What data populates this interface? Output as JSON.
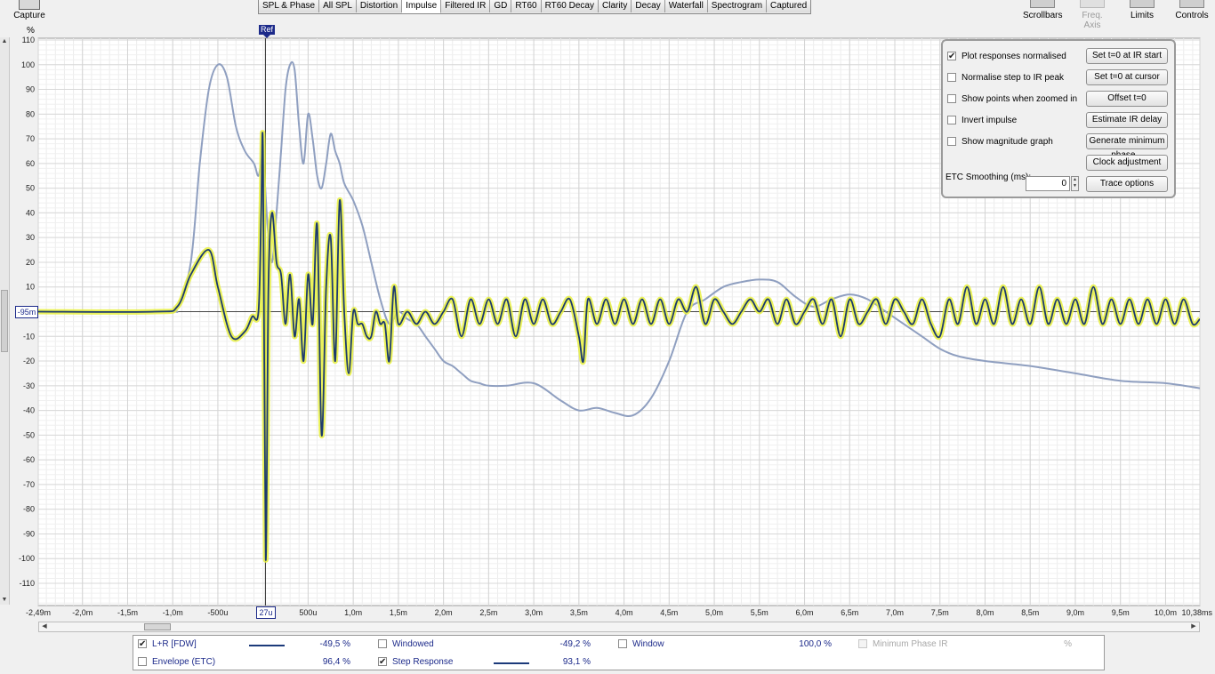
{
  "toolbar": {
    "capture_label": "Capture",
    "tabs": [
      "SPL & Phase",
      "All SPL",
      "Distortion",
      "Impulse",
      "Filtered IR",
      "GD",
      "RT60",
      "RT60 Decay",
      "Clarity",
      "Decay",
      "Waterfall",
      "Spectrogram",
      "Captured"
    ],
    "active_tab": "Impulse",
    "tools": [
      "Scrollbars",
      "Freq. Axis",
      "Limits",
      "Controls"
    ]
  },
  "plot": {
    "unit": "%",
    "ref_label": "Ref",
    "cursor_x_label": "27u",
    "cursor_y_label": "-95m"
  },
  "controls": {
    "checkboxes": [
      {
        "label": "Plot responses normalised",
        "checked": true
      },
      {
        "label": "Normalise step to IR peak",
        "checked": false
      },
      {
        "label": "Show points when zoomed in",
        "checked": false
      },
      {
        "label": "Invert impulse",
        "checked": false
      },
      {
        "label": "Show magnitude graph",
        "checked": false
      }
    ],
    "buttons": [
      "Set t=0 at IR start",
      "Set t=0 at cursor",
      "Offset t=0",
      "Estimate IR delay",
      "Generate minimum phase...",
      "Clock adjustment",
      "Trace options"
    ],
    "etc_label": "ETC Smoothing (ms):",
    "etc_value": "0"
  },
  "legend": {
    "items": [
      {
        "label": "L+R [FDW]",
        "checked": true,
        "value": "-49,5 %"
      },
      {
        "label": "Envelope (ETC)",
        "checked": false,
        "value": "96,4 %"
      },
      {
        "label": "Windowed",
        "checked": false,
        "value": "-49,2 %"
      },
      {
        "label": "Step Response",
        "checked": true,
        "value": "93,1 %"
      },
      {
        "label": "Window",
        "checked": false,
        "value": "100,0 %"
      },
      {
        "label": "Minimum Phase IR",
        "checked": false,
        "value": "%"
      }
    ]
  },
  "colors": {
    "impulse": "#1c3a6e",
    "impulse_glow": "#e8f040",
    "step": "#8f9fc0",
    "axis": "#1c2a8a"
  },
  "chart_data": {
    "type": "line",
    "ylabel": "%",
    "xlim": [
      -2.49,
      10.38
    ],
    "ylim": [
      -120,
      110
    ],
    "x_ticks": [
      "-2,49m",
      "-2,0m",
      "-1,5m",
      "-1,0m",
      "-500u",
      "27u",
      "500u",
      "1,0m",
      "1,5m",
      "2,0m",
      "2,5m",
      "3,0m",
      "3,5m",
      "4,0m",
      "4,5m",
      "5,0m",
      "5,5m",
      "6,0m",
      "6,5m",
      "7,0m",
      "7,5m",
      "8,0m",
      "8,5m",
      "9,0m",
      "9,5m",
      "10,0m",
      "10,38ms"
    ],
    "x_tick_values": [
      -2.49,
      -2.0,
      -1.5,
      -1.0,
      -0.5,
      0.027,
      0.5,
      1.0,
      1.5,
      2.0,
      2.5,
      3.0,
      3.5,
      4.0,
      4.5,
      5.0,
      5.5,
      6.0,
      6.5,
      7.0,
      7.5,
      8.0,
      8.5,
      9.0,
      9.5,
      10.0,
      10.38
    ],
    "y_ticks": [
      110,
      100,
      90,
      80,
      70,
      60,
      50,
      40,
      30,
      20,
      10,
      0,
      -10,
      -20,
      -30,
      -40,
      -50,
      -60,
      -70,
      -80,
      -90,
      -100,
      -110
    ],
    "series": [
      {
        "name": "L+R [FDW]",
        "color": "#1c3a6e",
        "x": [
          -2.49,
          -1.2,
          -0.95,
          -0.8,
          -0.6,
          -0.5,
          -0.35,
          -0.2,
          -0.12,
          -0.05,
          -0.02,
          0.0,
          0.03,
          0.06,
          0.1,
          0.15,
          0.2,
          0.25,
          0.3,
          0.35,
          0.4,
          0.45,
          0.5,
          0.55,
          0.6,
          0.65,
          0.7,
          0.75,
          0.8,
          0.85,
          0.9,
          0.95,
          1.0,
          1.05,
          1.1,
          1.15,
          1.2,
          1.25,
          1.3,
          1.35,
          1.4,
          1.45,
          1.5,
          1.6,
          1.7,
          1.8,
          1.9,
          2.0,
          2.1,
          2.2,
          2.3,
          2.4,
          2.5,
          2.6,
          2.7,
          2.8,
          2.9,
          3.0,
          3.1,
          3.2,
          3.3,
          3.4,
          3.5,
          3.55,
          3.6,
          3.7,
          3.8,
          3.9,
          4.0,
          4.1,
          4.2,
          4.3,
          4.4,
          4.5,
          4.6,
          4.7,
          4.8,
          4.9,
          5.0,
          5.1,
          5.2,
          5.3,
          5.4,
          5.5,
          5.6,
          5.7,
          5.8,
          5.9,
          6.0,
          6.1,
          6.2,
          6.3,
          6.4,
          6.5,
          6.6,
          6.7,
          6.8,
          6.9,
          7.0,
          7.1,
          7.2,
          7.3,
          7.4,
          7.5,
          7.6,
          7.7,
          7.8,
          7.9,
          8.0,
          8.1,
          8.2,
          8.3,
          8.4,
          8.5,
          8.6,
          8.7,
          8.8,
          8.9,
          9.0,
          9.1,
          9.2,
          9.3,
          9.4,
          9.5,
          9.6,
          9.7,
          9.8,
          9.9,
          10.0,
          10.1,
          10.2,
          10.3,
          10.38
        ],
        "y": [
          0,
          0,
          2,
          15,
          25,
          10,
          -10,
          -8,
          -2,
          0,
          40,
          65,
          -100,
          10,
          40,
          20,
          15,
          -5,
          15,
          -10,
          5,
          -20,
          15,
          -5,
          35,
          -50,
          10,
          30,
          -20,
          45,
          0,
          -25,
          0,
          -5,
          -5,
          -10,
          -10,
          0,
          -5,
          -5,
          -20,
          10,
          -5,
          0,
          -5,
          0,
          -5,
          0,
          5,
          -10,
          5,
          -5,
          5,
          -5,
          5,
          -10,
          5,
          -5,
          5,
          -5,
          0,
          5,
          -10,
          -20,
          5,
          -5,
          5,
          -5,
          5,
          -5,
          5,
          -5,
          5,
          -5,
          5,
          0,
          10,
          -5,
          5,
          0,
          -5,
          0,
          5,
          0,
          5,
          -5,
          5,
          -5,
          0,
          5,
          -5,
          5,
          -10,
          5,
          -5,
          0,
          5,
          -5,
          5,
          0,
          -5,
          5,
          -5,
          -10,
          5,
          -5,
          10,
          -5,
          5,
          -5,
          10,
          -5,
          5,
          -5,
          10,
          -5,
          5,
          -5,
          5,
          -5,
          10,
          -5,
          5,
          -5,
          5,
          -5,
          5,
          -5,
          5,
          -5,
          5,
          -5,
          -3
        ],
        "highlight": true
      },
      {
        "name": "Step Response",
        "color": "#8f9fc0",
        "x": [
          -2.49,
          -1.1,
          -0.95,
          -0.8,
          -0.7,
          -0.6,
          -0.5,
          -0.4,
          -0.3,
          -0.2,
          -0.1,
          -0.05,
          0.0,
          0.05,
          0.1,
          0.15,
          0.2,
          0.25,
          0.3,
          0.35,
          0.4,
          0.45,
          0.5,
          0.55,
          0.6,
          0.65,
          0.7,
          0.75,
          0.8,
          0.85,
          0.9,
          1.0,
          1.1,
          1.2,
          1.3,
          1.4,
          1.5,
          1.6,
          1.7,
          1.8,
          1.9,
          2.0,
          2.1,
          2.2,
          2.3,
          2.4,
          2.5,
          2.7,
          3.0,
          3.3,
          3.5,
          3.7,
          3.9,
          4.1,
          4.3,
          4.5,
          4.7,
          4.9,
          5.1,
          5.3,
          5.5,
          5.7,
          5.9,
          6.1,
          6.3,
          6.5,
          6.7,
          6.9,
          7.1,
          7.3,
          7.5,
          7.7,
          8.0,
          8.5,
          9.0,
          9.5,
          10.0,
          10.38
        ],
        "y": [
          0,
          0,
          2,
          20,
          60,
          90,
          100,
          95,
          75,
          65,
          60,
          55,
          62,
          35,
          20,
          40,
          65,
          90,
          100,
          98,
          75,
          60,
          80,
          70,
          55,
          50,
          60,
          72,
          65,
          60,
          52,
          45,
          35,
          20,
          5,
          -5,
          0,
          -3,
          -5,
          -10,
          -15,
          -20,
          -22,
          -25,
          -28,
          -29,
          -30,
          -30,
          -29,
          -36,
          -40,
          -39,
          -41,
          -42,
          -35,
          -20,
          0,
          5,
          10,
          12,
          13,
          12,
          6,
          2,
          5,
          7,
          5,
          0,
          -5,
          -10,
          -15,
          -18,
          -20,
          -22,
          -25,
          -28,
          -29,
          -31
        ],
        "highlight": false
      }
    ],
    "grid": true,
    "legend": "bottom"
  }
}
